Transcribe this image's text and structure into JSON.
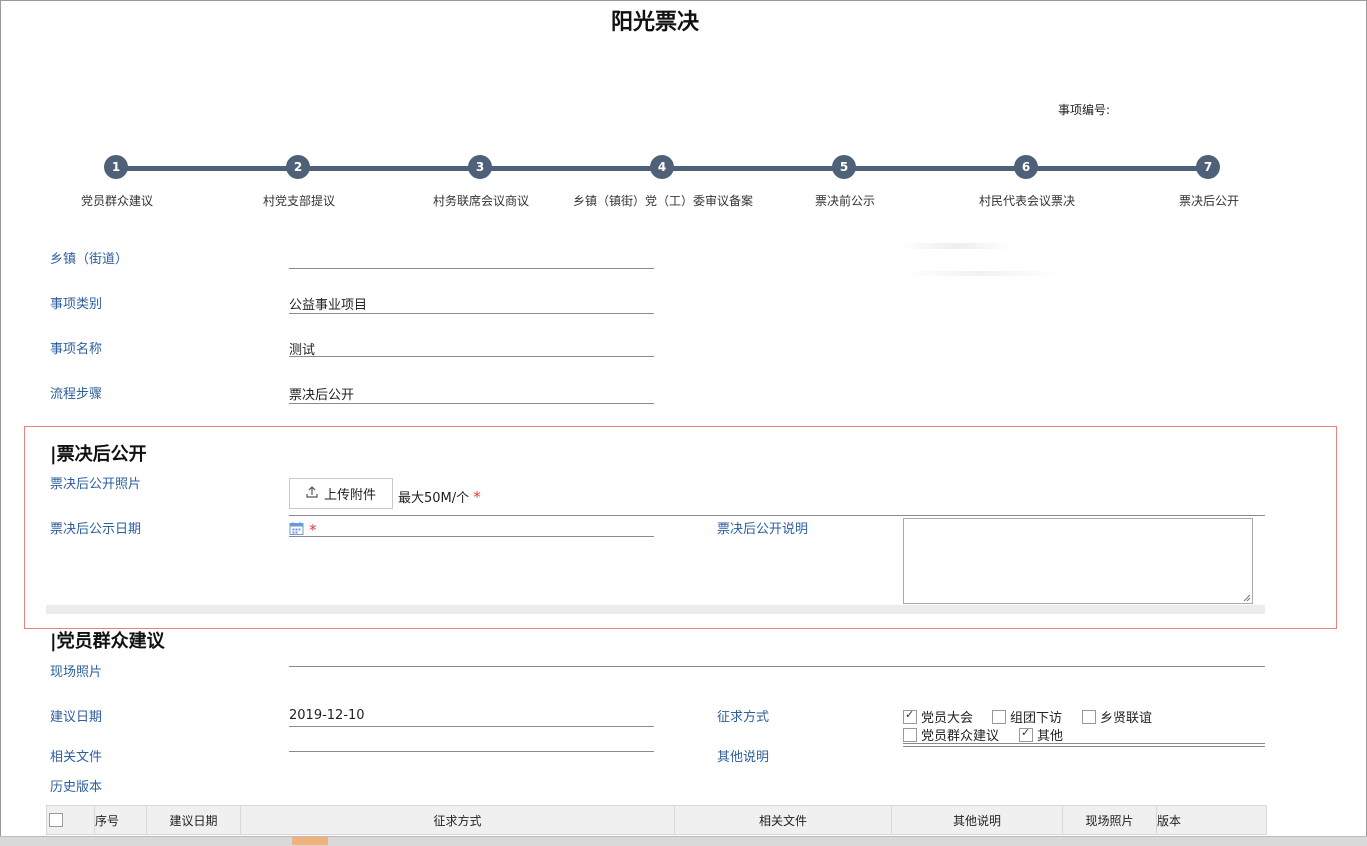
{
  "page": {
    "title": "阳光票决",
    "item_no_label": "事项编号:"
  },
  "steps": [
    {
      "num": "1",
      "label": "党员群众建议"
    },
    {
      "num": "2",
      "label": "村党支部提议"
    },
    {
      "num": "3",
      "label": "村务联席会议商议"
    },
    {
      "num": "4",
      "label": "乡镇（镇街）党（工）委审议备案"
    },
    {
      "num": "5",
      "label": "票决前公示"
    },
    {
      "num": "6",
      "label": "村民代表会议票决"
    },
    {
      "num": "7",
      "label": "票决后公开"
    }
  ],
  "info": {
    "township_label": "乡镇（街道）",
    "township_value": "",
    "category_label": "事项类别",
    "category_value": "公益事业项目",
    "name_label": "事项名称",
    "name_value": "测试",
    "step_label": "流程步骤",
    "step_value": "票决后公开"
  },
  "post_vote": {
    "section_title": "|票决后公开",
    "photo_label": "票决后公开照片",
    "upload_label": "上传附件",
    "max_size": "最大50M/个",
    "required_mark": "*",
    "date_label": "票决后公示日期",
    "desc_label": "票决后公开说明",
    "desc_value": ""
  },
  "suggestion": {
    "section_title": "|党员群众建议",
    "photo_label": "现场照片",
    "date_label": "建议日期",
    "date_value": "2019-12-10",
    "method_label": "征求方式",
    "methods": [
      {
        "label": "党员大会",
        "checked": true
      },
      {
        "label": "组团下访",
        "checked": false
      },
      {
        "label": "乡贤联谊",
        "checked": false
      },
      {
        "label": "党员群众建议",
        "checked": false
      },
      {
        "label": "其他",
        "checked": true
      }
    ],
    "files_label": "相关文件",
    "other_label": "其他说明",
    "history_label": "历史版本"
  },
  "history_table": {
    "columns": [
      "序号",
      "建议日期",
      "征求方式",
      "相关文件",
      "其他说明",
      "现场照片",
      "版本"
    ]
  },
  "colors": {
    "accent": "#4f6178",
    "label": "#2d5e9e",
    "required": "#e23b3b",
    "highlight_border": "#e8827b"
  }
}
